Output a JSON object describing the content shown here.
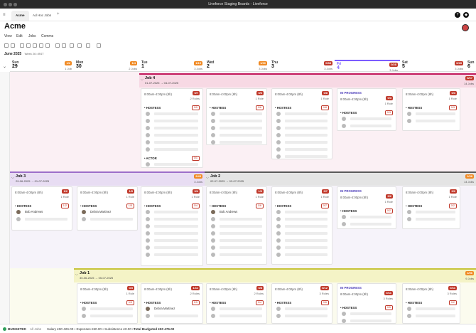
{
  "window": {
    "title": "Liveforce Staging Boards - Liveforce"
  },
  "tabs": [
    {
      "label": "Acme"
    },
    {
      "label": "Ad Hoc Jobs"
    }
  ],
  "app": {
    "title": "Acme"
  },
  "menu": [
    "View",
    "Edit",
    "Jobs",
    "Comms"
  ],
  "week": {
    "label": "June 2025",
    "sub": "Week 26 • BST"
  },
  "days": [
    {
      "name": "Sun",
      "num": "29",
      "badge": "1/2",
      "jobs": "1 Job"
    },
    {
      "name": "Mon",
      "num": "30",
      "badge": "1/4",
      "jobs": "2 Jobs"
    },
    {
      "name": "Tue",
      "num": "1",
      "badge": "1/19",
      "jobs": "3 Jobs"
    },
    {
      "name": "Wed",
      "num": "2",
      "badge": "1/30",
      "jobs": "3 Jobs"
    },
    {
      "name": "Thu",
      "num": "3",
      "badge": "0/38",
      "jobs": "3 Jobs"
    },
    {
      "name": "Fri",
      "num": "4",
      "badge": "0/28",
      "jobs": "3 Jobs"
    },
    {
      "name": "Sat",
      "num": "5",
      "badge": "0/28",
      "jobs": "3 Jobs"
    },
    {
      "name": "Sun",
      "num": "6",
      "badge": "",
      "jobs": ""
    }
  ],
  "jobs": {
    "job4": {
      "title": "Job 4",
      "dates": "01-07-2025 → 04-07-2025",
      "badge": "3/67",
      "roles": "14 Jobs"
    },
    "job3": {
      "title": "Job 3",
      "dates": "29-06-2025 → 01-07-2025",
      "badge": "2/45",
      "roles": "3 Jobs"
    },
    "job2": {
      "title": "Job 2",
      "dates": "02-07-2025 → 03-07-2025",
      "badge": "1/38",
      "roles": "14 Jobs"
    },
    "job1": {
      "title": "Job 1",
      "dates": "30-06-2025 → 05-07-2025",
      "badge": "1/56",
      "roles": "9 Jobs"
    }
  },
  "labels": {
    "shift": "8:00am-4:00pm (8h)",
    "hostess": "• HOSTESS",
    "actor": "• ACTOR",
    "in_progress": "IN PROGRESS",
    "one_role": "1 Role",
    "two_roles": "2 Roles",
    "three_roles": "3 Roles"
  },
  "people": {
    "bob": "Bob Andrews",
    "debra": "Debra Martinez"
  },
  "footer": {
    "budgeted": "BUDGETED",
    "all_jobs": "All Jobs",
    "summary": "Salary £90 426.00 • Expenses £50.00 • Subsistence £0.00 •",
    "total": "Total Budgeted £90 476.00"
  },
  "colors": {
    "accent": "#7b5cff",
    "job4": "#c2185b",
    "job3": "#9c6fc9",
    "job2": "#5a5a5a",
    "job1": "#c7c43a",
    "badge": "#c0392b",
    "orange": "#f08a24"
  }
}
